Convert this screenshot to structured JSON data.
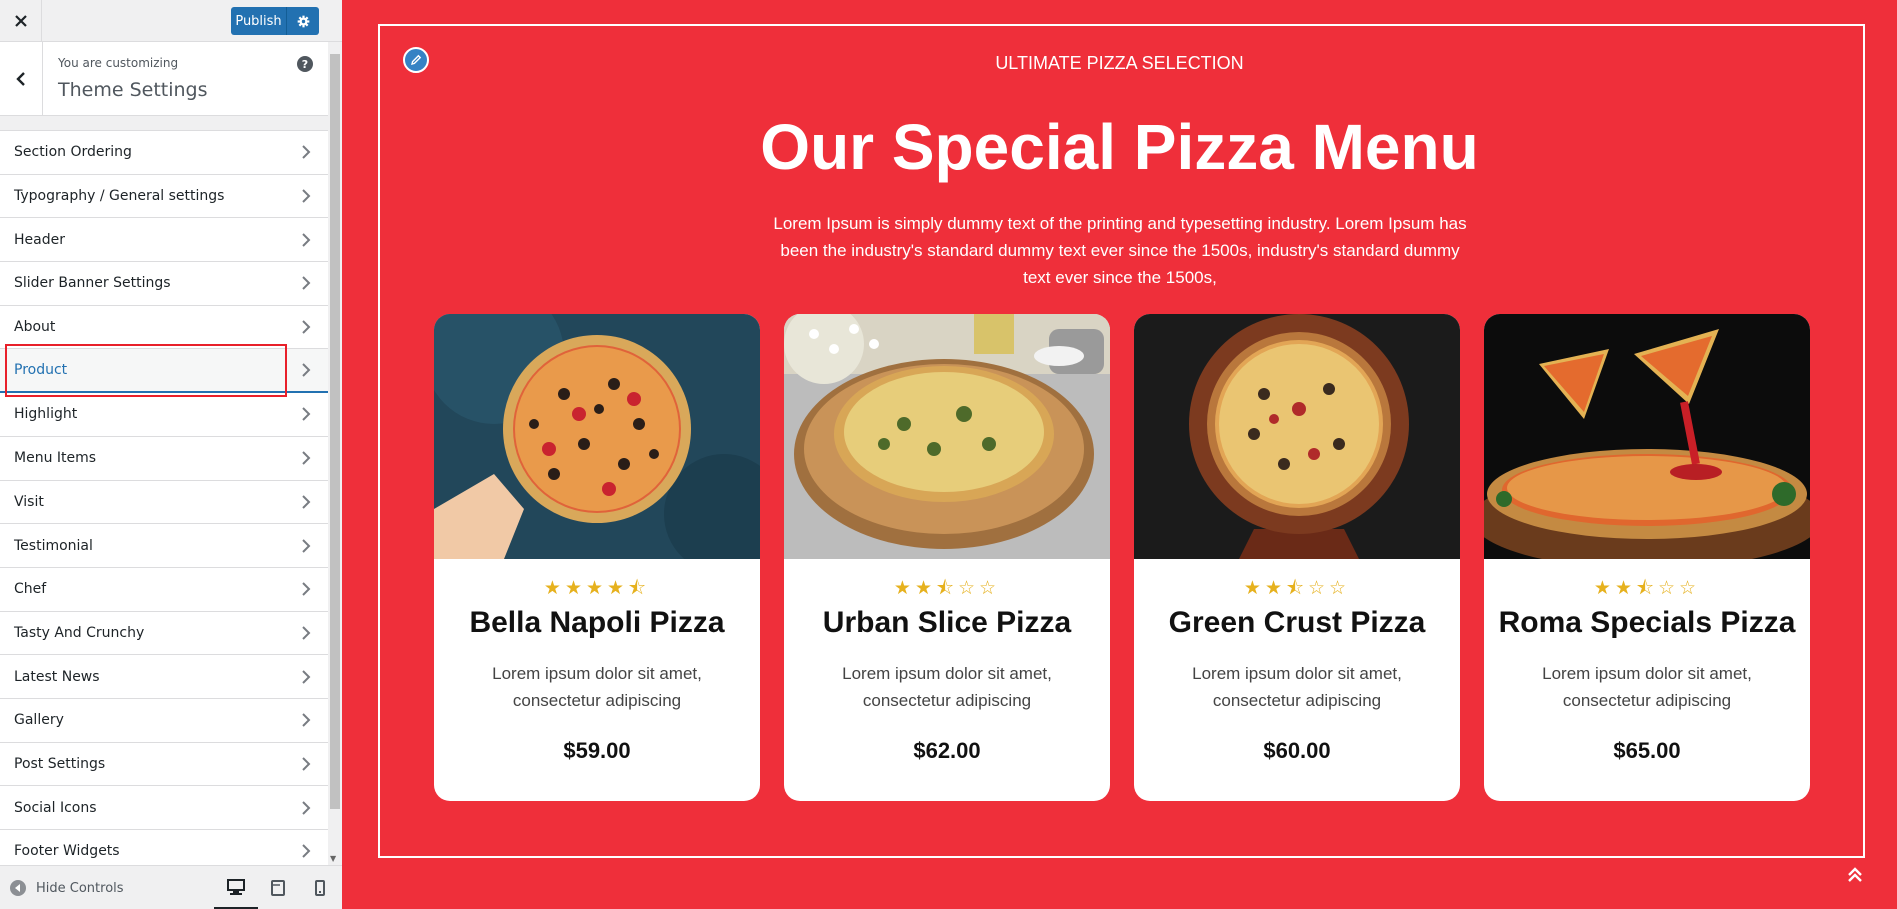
{
  "topbar": {
    "publish_label": "Publish"
  },
  "info": {
    "customizing_label": "You are customizing",
    "title": "Theme Settings",
    "help": "?"
  },
  "sections": [
    {
      "label": "Section Ordering"
    },
    {
      "label": "Typography / General settings"
    },
    {
      "label": "Header"
    },
    {
      "label": "Slider Banner Settings"
    },
    {
      "label": "About"
    },
    {
      "label": "Product"
    },
    {
      "label": "Highlight"
    },
    {
      "label": "Menu Items"
    },
    {
      "label": "Visit"
    },
    {
      "label": "Testimonial"
    },
    {
      "label": "Chef"
    },
    {
      "label": "Tasty And Crunchy"
    },
    {
      "label": "Latest News"
    },
    {
      "label": "Gallery"
    },
    {
      "label": "Post Settings"
    },
    {
      "label": "Social Icons"
    },
    {
      "label": "Footer Widgets"
    }
  ],
  "active_section": "Product",
  "footer": {
    "hide_controls": "Hide Controls"
  },
  "preview": {
    "kicker": "ULTIMATE PIZZA SELECTION",
    "headline": "Our Special Pizza Menu",
    "intro": "Lorem Ipsum is simply dummy text of the printing and typesetting industry. Lorem Ipsum has been the industry's standard dummy text ever since the 1500s, industry's standard dummy text ever since the 1500s,",
    "products": [
      {
        "name": "Bella Napoli Pizza",
        "rating": 4.5,
        "stars": "★★★★⯪",
        "desc": "Lorem ipsum dolor sit amet, consectetur adipiscing",
        "price": "$59.00"
      },
      {
        "name": "Urban Slice Pizza",
        "rating": 2.5,
        "stars": "★★⯪☆☆",
        "desc": "Lorem ipsum dolor sit amet, consectetur adipiscing",
        "price": "$62.00"
      },
      {
        "name": "Green Crust Pizza",
        "rating": 2.5,
        "stars": "★★⯪☆☆",
        "desc": "Lorem ipsum dolor sit amet, consectetur adipiscing",
        "price": "$60.00"
      },
      {
        "name": "Roma Specials Pizza",
        "rating": 2.5,
        "stars": "★★⯪☆☆",
        "desc": "Lorem ipsum dolor sit amet, consectetur adipiscing",
        "price": "$65.00"
      }
    ]
  },
  "colors": {
    "accent": "#2271b1",
    "preview_bg": "#ef2f3a",
    "star": "#e6b11e",
    "highlight_box": "#e8202a"
  },
  "icons": [
    "close-icon",
    "gear-icon",
    "back-chevron-icon",
    "help-icon",
    "chevron-right-icon",
    "hide-controls-icon",
    "desktop-icon",
    "tablet-icon",
    "mobile-icon",
    "pencil-icon",
    "double-chevron-up-icon"
  ]
}
